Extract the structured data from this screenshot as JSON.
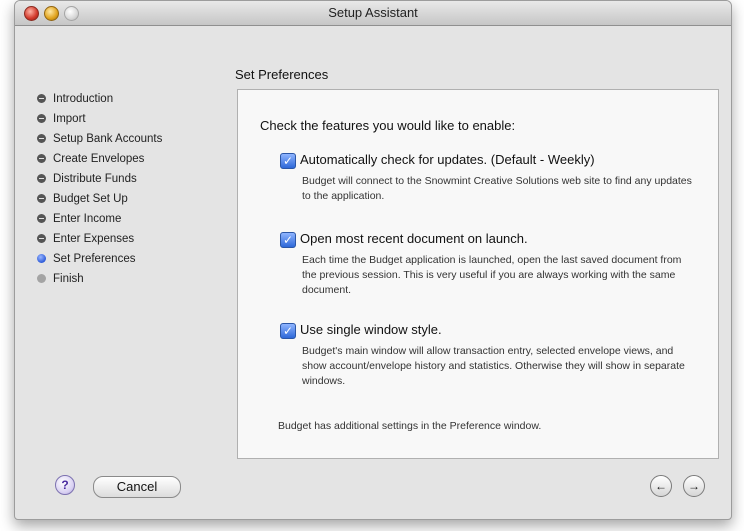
{
  "window": {
    "title": "Setup Assistant"
  },
  "steps": [
    {
      "label": "Introduction",
      "state": "done"
    },
    {
      "label": "Import",
      "state": "done"
    },
    {
      "label": "Setup Bank Accounts",
      "state": "done"
    },
    {
      "label": "Create Envelopes",
      "state": "done"
    },
    {
      "label": "Distribute Funds",
      "state": "done"
    },
    {
      "label": "Budget Set Up",
      "state": "done"
    },
    {
      "label": "Enter Income",
      "state": "done"
    },
    {
      "label": "Enter Expenses",
      "state": "done"
    },
    {
      "label": "Set Preferences",
      "state": "current"
    },
    {
      "label": "Finish",
      "state": "todo"
    }
  ],
  "main": {
    "heading": "Set Preferences",
    "intro": "Check the features you would like to enable:",
    "options": [
      {
        "label": "Automatically check for updates.  (Default - Weekly)",
        "checked": true,
        "description": "Budget will connect to the Snowmint Creative Solutions web site to find any updates to the application."
      },
      {
        "label": "Open most recent document on launch.",
        "checked": true,
        "description": "Each time the Budget application is launched, open the last saved document from the previous session.  This is very useful if you are always working with the same document."
      },
      {
        "label": "Use single window style.",
        "checked": true,
        "description": "Budget's main window will allow transaction entry, selected envelope views, and show account/envelope history and statistics.  Otherwise they will show in separate windows."
      }
    ],
    "footer_note": "Budget has additional settings in the Preference window."
  },
  "buttons": {
    "help": "?",
    "cancel": "Cancel",
    "back_icon": "back-arrow-icon",
    "forward_icon": "forward-arrow-icon"
  },
  "colors": {
    "current_step": "#2d5bd8",
    "checkbox": "#2d68d8",
    "help": "#4a2ba0"
  }
}
